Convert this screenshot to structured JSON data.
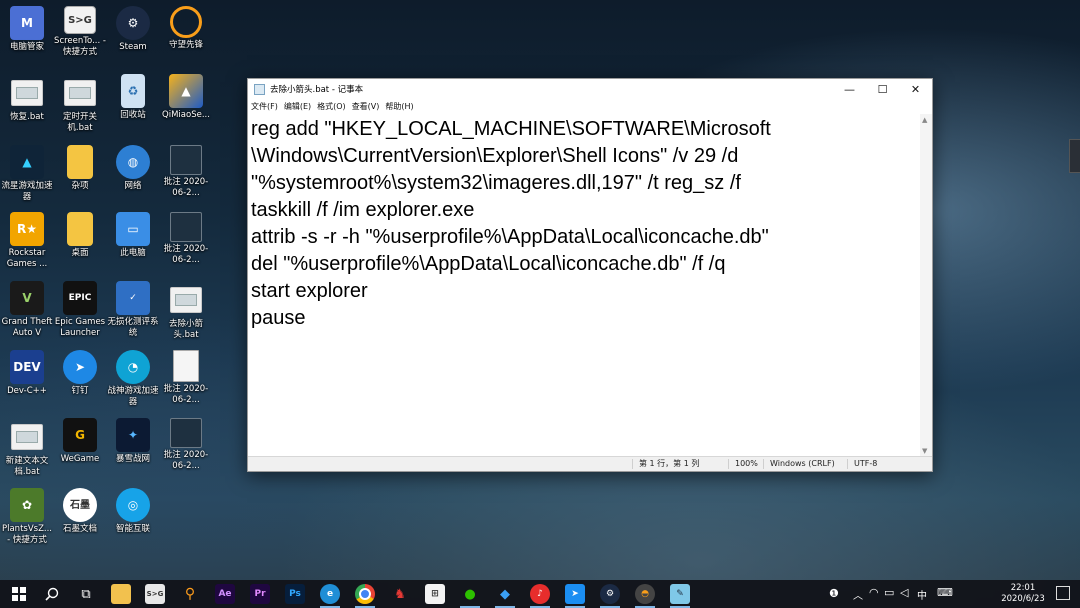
{
  "desktop": {
    "icons": [
      {
        "label": "电脑管家",
        "icon": "pc-manager-icon"
      },
      {
        "label": "ScreenTo... - 快捷方式",
        "icon": "screento-icon"
      },
      {
        "label": "Steam",
        "icon": "steam-icon"
      },
      {
        "label": "守望先锋",
        "icon": "overwatch-icon"
      },
      {
        "label": "恢复.bat",
        "icon": "bat-file-icon"
      },
      {
        "label": "定时开关机.bat",
        "icon": "bat-file-icon"
      },
      {
        "label": "回收站",
        "icon": "recycle-bin-icon"
      },
      {
        "label": "QiMiaoSe...",
        "icon": "qimiao-icon"
      },
      {
        "label": "流星游戏加速器",
        "icon": "meteor-accelerator-icon"
      },
      {
        "label": "杂项",
        "icon": "folder-icon"
      },
      {
        "label": "网络",
        "icon": "network-icon"
      },
      {
        "label": "批注 2020-06-2...",
        "icon": "screenshot-thumb-icon"
      },
      {
        "label": "Rockstar Games ...",
        "icon": "rockstar-icon"
      },
      {
        "label": "桌面",
        "icon": "desktop-folder-icon"
      },
      {
        "label": "此电脑",
        "icon": "this-pc-icon"
      },
      {
        "label": "批注 2020-06-2...",
        "icon": "screenshot-thumb-icon"
      },
      {
        "label": "Grand Theft Auto V",
        "icon": "gta-icon"
      },
      {
        "label": "Epic Games Launcher",
        "icon": "epic-games-icon"
      },
      {
        "label": "无损化测评系统",
        "icon": "benchmark-icon"
      },
      {
        "label": "去除小箭头.bat",
        "icon": "bat-file-icon"
      },
      {
        "label": "Dev-C++",
        "icon": "devcpp-icon"
      },
      {
        "label": "钉钉",
        "icon": "dingtalk-icon"
      },
      {
        "label": "战神游戏加速器",
        "icon": "zhanshen-accelerator-icon"
      },
      {
        "label": "批注 2020-06-2...",
        "icon": "screenshot-thumb-icon"
      },
      {
        "label": "新建文本文档.bat",
        "icon": "bat-file-icon"
      },
      {
        "label": "WeGame",
        "icon": "wegame-icon"
      },
      {
        "label": "暴雪战网",
        "icon": "battlenet-icon"
      },
      {
        "label": "批注 2020-06-2...",
        "icon": "screenshot-thumb-icon"
      },
      {
        "label": "PlantsVsZ... - 快捷方式",
        "icon": "plants-vs-zombies-icon"
      },
      {
        "label": "石墨文档",
        "icon": "shimo-docs-icon"
      },
      {
        "label": "智能互联",
        "icon": "smart-connect-icon"
      }
    ]
  },
  "notepad": {
    "title": "去除小箭头.bat - 记事本",
    "menu": [
      "文件(F)",
      "编辑(E)",
      "格式(O)",
      "查看(V)",
      "帮助(H)"
    ],
    "content": "reg add \"HKEY_LOCAL_MACHINE\\SOFTWARE\\Microsoft\n\\Windows\\CurrentVersion\\Explorer\\Shell Icons\" /v 29 /d\n\"%systemroot%\\system32\\imageres.dll,197\" /t reg_sz /f\ntaskkill /f /im explorer.exe\nattrib -s -r -h \"%userprofile%\\AppData\\Local\\iconcache.db\"\ndel \"%userprofile%\\AppData\\Local\\iconcache.db\" /f /q\nstart explorer\npause",
    "status": {
      "position": "第 1 行，第 1 列",
      "zoom": "100%",
      "line_ending": "Windows (CRLF)",
      "encoding": "UTF-8"
    },
    "controls": {
      "minimize": "—",
      "maximize": "☐",
      "close": "✕"
    }
  },
  "taskbar": {
    "lang": "中",
    "time": "22:01",
    "date": "2020/6/23",
    "apps": [
      "start",
      "search",
      "task-view",
      "file-explorer",
      "screento",
      "search-tool",
      "after-effects",
      "premiere",
      "photoshop",
      "edge",
      "chrome",
      "tray-app",
      "store",
      "wechat",
      "wps",
      "netease-music",
      "dingtalk",
      "steam",
      "overwatch",
      "notepad"
    ],
    "app_labels": {
      "ae": "Ae",
      "pr": "Pr",
      "ps": "Ps"
    }
  }
}
